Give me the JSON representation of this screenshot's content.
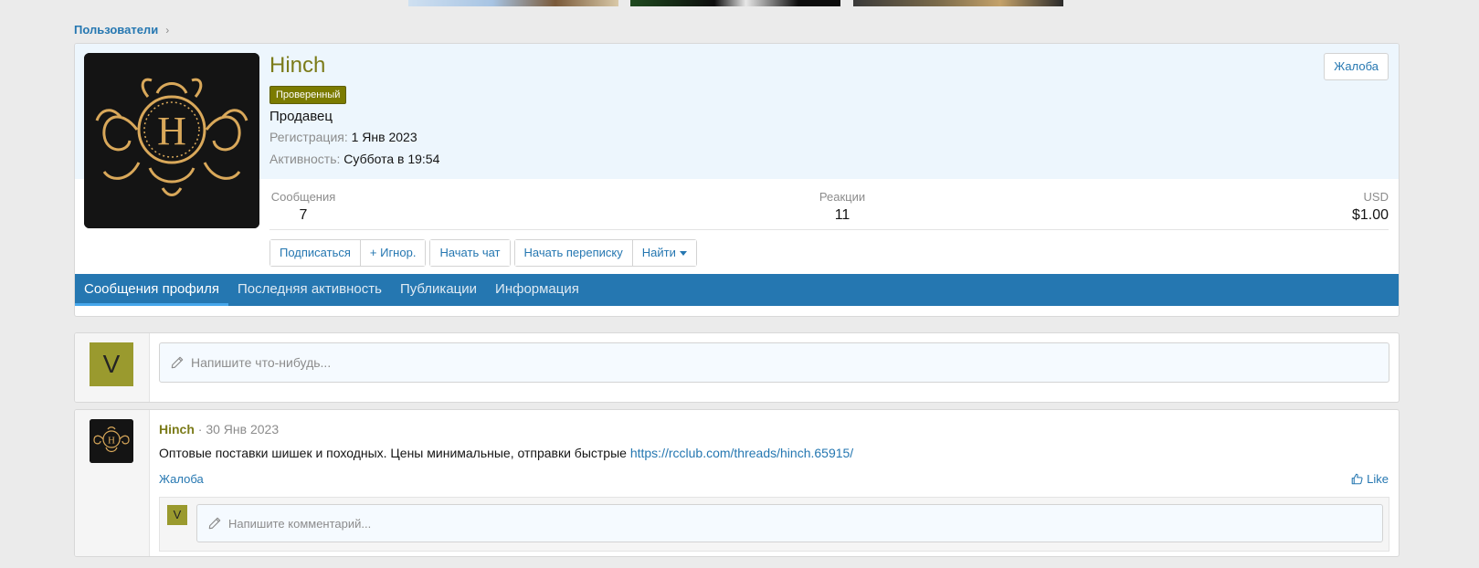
{
  "breadcrumb": {
    "label": "Пользователи"
  },
  "profile": {
    "username": "Hinch",
    "badge": "Проверенный",
    "title": "Продавец",
    "registration_label": "Регистрация:",
    "registration_value": "1 Янв 2023",
    "activity_label": "Активность:",
    "activity_value": "Суббота в 19:54",
    "report_label": "Жалоба",
    "avatar_letter": "H",
    "stats": {
      "messages_label": "Сообщения",
      "messages_value": "7",
      "reactions_label": "Реакции",
      "reactions_value": "11",
      "usd_label": "USD",
      "usd_value": "$1.00"
    },
    "actions": {
      "follow": "Подписаться",
      "ignore": "+ Игнор.",
      "chat": "Начать чат",
      "conversation": "Начать переписку",
      "find": "Найти"
    },
    "tabs": [
      {
        "label": "Сообщения профиля"
      },
      {
        "label": "Последняя активность"
      },
      {
        "label": "Публикации"
      },
      {
        "label": "Информация"
      }
    ]
  },
  "composer": {
    "avatar_letter": "V",
    "placeholder": "Напишите что-нибудь..."
  },
  "post": {
    "author": "Hinch",
    "date_sep": " · ",
    "date": "30 Янв 2023",
    "body_text": "Оптовые поставки шишек и походных. Цены минимальные, отправки быстрые ",
    "link": "https://rcclub.com/threads/hinch.65915/",
    "report_label": "Жалоба",
    "like_label": "Like",
    "comment_avatar_letter": "V",
    "comment_placeholder": "Напишите комментарий..."
  },
  "colors": {
    "accent": "#2577b1",
    "username": "#7b7b19",
    "badge": "#7b7b00",
    "avatar_v": "#9a9a2e",
    "profile_bg": "#edf6fd"
  }
}
